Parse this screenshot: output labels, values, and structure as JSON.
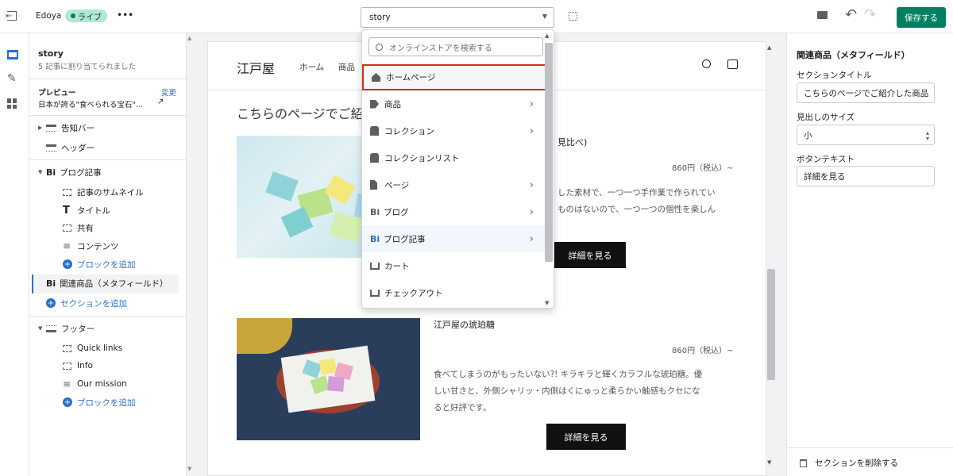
{
  "topbar": {
    "store_name": "Edoya",
    "live_badge": "ライブ",
    "more": "•••",
    "template_select": "story",
    "save_label": "保存する"
  },
  "left": {
    "template_name": "story",
    "template_sub": "5 記事に割り当てられました",
    "preview_label": "プレビュー",
    "change_label": "変更",
    "preview_value": "日本が誇る\"食べられる宝石\"...",
    "items": [
      {
        "label": "告知バー"
      },
      {
        "label": "ヘッダー"
      },
      {
        "label": "ブログ記事"
      },
      {
        "label": "記事のサムネイル"
      },
      {
        "label": "タイトル"
      },
      {
        "label": "共有"
      },
      {
        "label": "コンテンツ"
      },
      {
        "label": "ブロックを追加"
      },
      {
        "label": "関連商品（メタフィールド）"
      },
      {
        "label": "セクションを追加"
      },
      {
        "label": "フッター"
      },
      {
        "label": "Quick links"
      },
      {
        "label": "Info"
      },
      {
        "label": "Our mission"
      },
      {
        "label": "ブロックを追加"
      }
    ]
  },
  "preview": {
    "logo": "江戸屋",
    "nav": [
      "ホーム",
      "商品"
    ],
    "section_title": "こちらのページでご紹介した商品",
    "products": [
      {
        "title": "見比べ)",
        "price": "860円（税込）~",
        "desc1": "した素材で、一つ一つ手作業で作られてい",
        "desc2": "ものはないので、一つ一つの個性を楽しん",
        "desc3": "",
        "button": "詳細を見る",
        "image_credit": ""
      },
      {
        "title": "江戸屋の琥珀糖",
        "price": "860円（税込）~",
        "desc1": "食べてしまうのがもったいない?! キラキラと輝くカラフルな琥珀糖。優",
        "desc2": "しい甘さと、外側シャリッ・内側はくにゅっと柔らかい触感もクセにな",
        "desc3": "ると好評です。",
        "button": "詳細を見る",
        "image_credit": ""
      }
    ]
  },
  "dropdown": {
    "search_placeholder": "オンラインストアを検索する",
    "items": [
      {
        "label": "ホームページ",
        "icon": "home-icon"
      },
      {
        "label": "商品",
        "icon": "tag-icon"
      },
      {
        "label": "コレクション",
        "icon": "collection-icon"
      },
      {
        "label": "コレクションリスト",
        "icon": "collection-icon"
      },
      {
        "label": "ページ",
        "icon": "page-icon"
      },
      {
        "label": "ブログ",
        "icon": "blog-icon"
      },
      {
        "label": "ブログ記事",
        "icon": "blog-icon"
      },
      {
        "label": "カート",
        "icon": "cart-icon"
      },
      {
        "label": "チェックアウト",
        "icon": "cart-icon"
      }
    ]
  },
  "right": {
    "title": "関連商品（メタフィールド）",
    "section_title_label": "セクションタイトル",
    "section_title_value": "こちらのページでご紹介した商品",
    "heading_size_label": "見出しのサイズ",
    "heading_size_value": "小",
    "button_text_label": "ボタンテキスト",
    "button_text_value": "詳細を見る",
    "delete_label": "セクションを削除する"
  },
  "colors": {
    "accent_green": "#008060",
    "live_green": "#aee9d1",
    "highlight_red": "#d72c0d",
    "link_blue": "#2c6ecb"
  }
}
